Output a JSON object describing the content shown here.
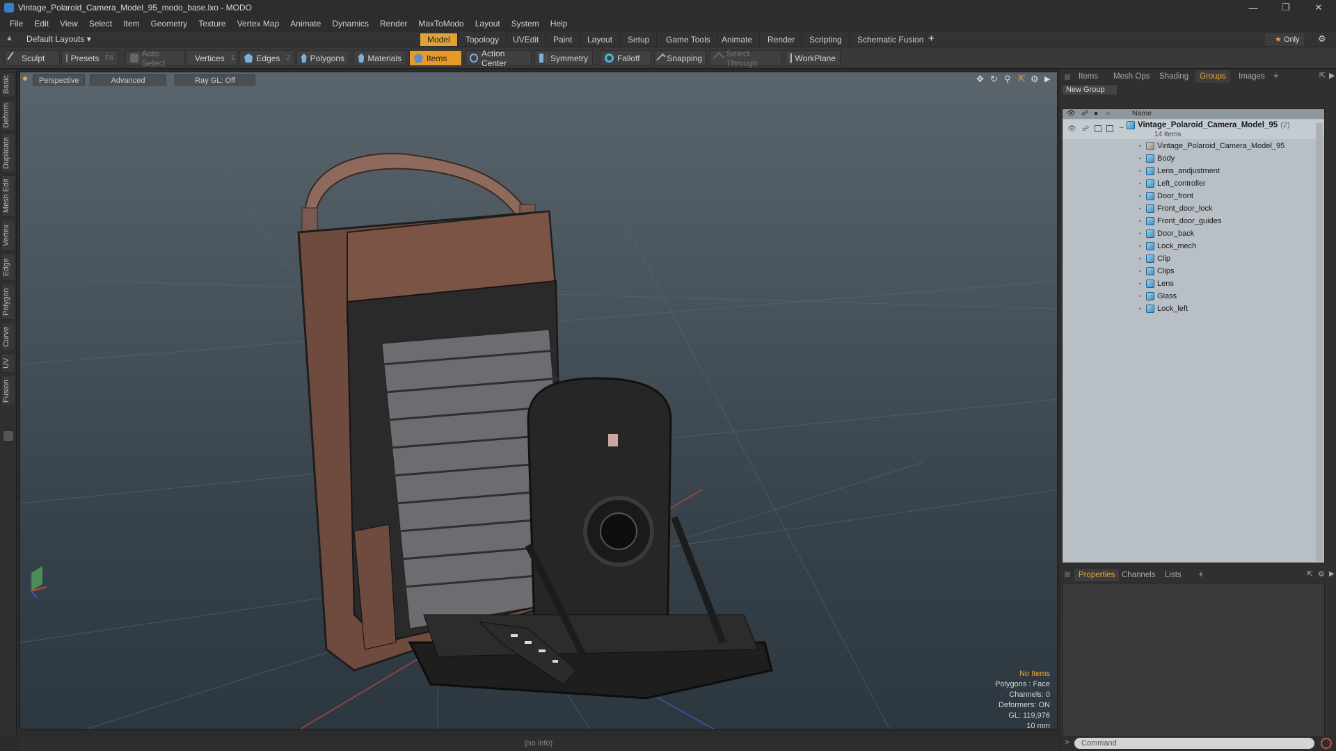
{
  "window": {
    "title": "Vintage_Polaroid_Camera_Model_95_modo_base.lxo - MODO",
    "controls": [
      "minimize-icon",
      "restore-icon",
      "close-icon"
    ]
  },
  "menu": [
    "File",
    "Edit",
    "View",
    "Select",
    "Item",
    "Geometry",
    "Texture",
    "Vertex Map",
    "Animate",
    "Dynamics",
    "Render",
    "MaxToModo",
    "Layout",
    "System",
    "Help"
  ],
  "layout": {
    "preset": "Default Layouts",
    "tabs": [
      "Model",
      "Topology",
      "UVEdit",
      "Paint",
      "Layout",
      "Setup",
      "Game Tools",
      "Animate",
      "Render",
      "Scripting",
      "Schematic Fusion"
    ],
    "active_tab": "Model",
    "add": "+",
    "only": "Only"
  },
  "toolbar": {
    "sculpt": "Sculpt",
    "presets": "Presets",
    "presets_hotkey": "F6",
    "auto_select": "Auto Select",
    "vertices": "Vertices",
    "vertices_hotkey": "1",
    "edges": "Edges",
    "edges_hotkey": "2",
    "polygons": "Polygons",
    "materials": "Materials",
    "items": "Items",
    "action_center": "Action Center",
    "symmetry": "Symmetry",
    "falloff": "Falloff",
    "snapping": "Snapping",
    "select_through": "Select Through",
    "workplane": "WorkPlane"
  },
  "left_tabs": [
    "Basic",
    "Deform",
    "Duplicate",
    "Mesh Edit",
    "Vertex",
    "Edge",
    "Polygon",
    "Curve",
    "UV",
    "Fusion"
  ],
  "viewport": {
    "view": "Perspective",
    "shading": "Advanced",
    "raygl": "Ray GL: Off",
    "info": {
      "selection": "No Items",
      "polygons": "Polygons : Face",
      "channels": "Channels: 0",
      "deformers": "Deformers: ON",
      "gl": "GL: 119,976",
      "scale": "10 mm"
    }
  },
  "status": "(no info)",
  "right_panel": {
    "top_tabs": [
      "Items",
      "Mesh Ops",
      "Shading",
      "Groups",
      "Images"
    ],
    "active_top_tab": "Groups",
    "new_group": "New Group",
    "column_name": "Name",
    "group": {
      "name": "Vintage_Polaroid_Camera_Model_95",
      "count": "(2)",
      "subtitle": "14 Items"
    },
    "items": [
      "Vintage_Polaroid_Camera_Model_95",
      "Body",
      "Lens_andjustment",
      "Left_controller",
      "Door_front",
      "Front_door_lock",
      "Front_door_guides",
      "Door_back",
      "Lock_mech",
      "Clip",
      "Clips",
      "Lens",
      "Glass",
      "Lock_left"
    ],
    "bottom_tabs": [
      "Properties",
      "Channels",
      "Lists"
    ],
    "active_bottom_tab": "Properties",
    "command_placeholder": "Command"
  },
  "colors": {
    "accent": "#e69a2a",
    "background": "#2b2b2b",
    "list_bg": "#b8bfc5"
  }
}
